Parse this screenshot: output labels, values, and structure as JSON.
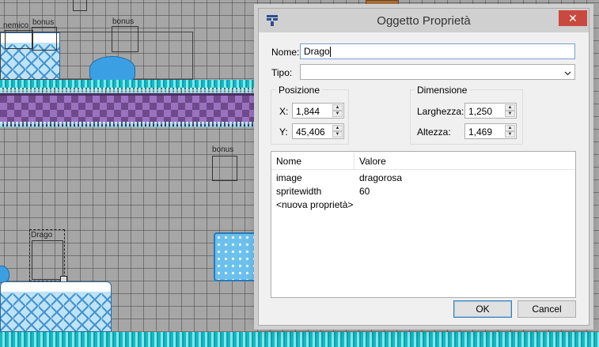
{
  "canvas": {
    "labels": {
      "nemico": "nemico",
      "bonus1": "bonus",
      "bonus2": "bonus",
      "bonus3": "bonus",
      "drago": "Drago"
    }
  },
  "dialog": {
    "title": "Oggetto Proprietà",
    "icon": "tiled-app-icon",
    "close_glyph": "✕",
    "name": {
      "label": "Nome:",
      "value": "Drago"
    },
    "type": {
      "label": "Tipo:",
      "value": ""
    },
    "position": {
      "group_label": "Posizione",
      "x_label": "X:",
      "x_value": "1,844",
      "y_label": "Y:",
      "y_value": "45,406"
    },
    "size": {
      "group_label": "Dimensione",
      "width_label": "Larghezza:",
      "width_value": "1,250",
      "height_label": "Altezza:",
      "height_value": "1,469"
    },
    "properties": {
      "columns": [
        "Nome",
        "Valore"
      ],
      "rows": [
        {
          "name": "image",
          "value": "dragorosa"
        },
        {
          "name": "spritewidth",
          "value": "60"
        },
        {
          "name": "<nuova proprietà>",
          "value": ""
        }
      ]
    },
    "ok_label": "OK",
    "cancel_label": "Cancel"
  }
}
